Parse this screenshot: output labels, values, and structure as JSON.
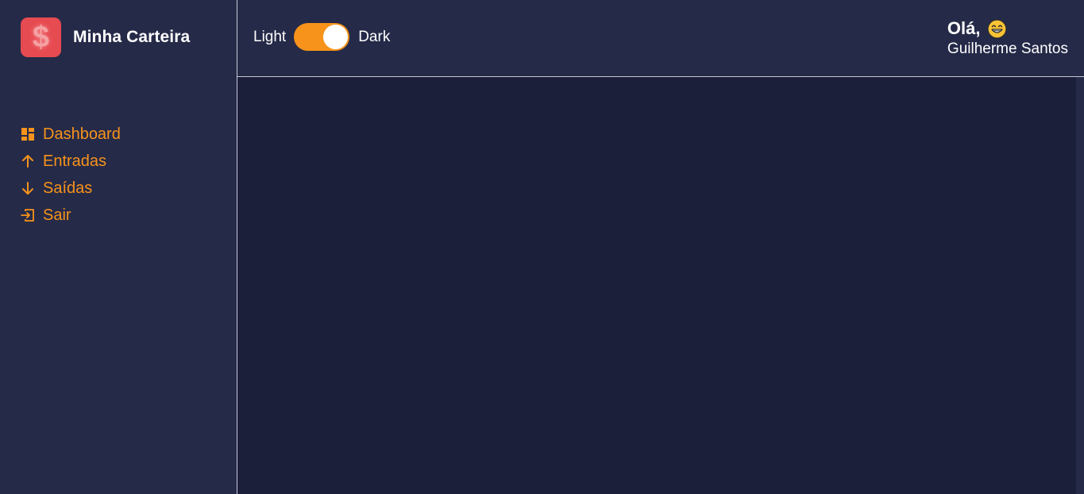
{
  "brand": {
    "logo_symbol": "$",
    "title": "Minha Carteira",
    "logo_color": "#e64b51"
  },
  "sidebar": {
    "items": [
      {
        "label": "Dashboard",
        "icon": "dashboard-icon"
      },
      {
        "label": "Entradas",
        "icon": "arrow-up-icon"
      },
      {
        "label": "Saídas",
        "icon": "arrow-down-icon"
      },
      {
        "label": "Sair",
        "icon": "exit-icon"
      }
    ],
    "accent_color": "#f7931b"
  },
  "header": {
    "theme_toggle": {
      "light_label": "Light",
      "dark_label": "Dark",
      "state": "dark"
    },
    "greeting": "Olá,",
    "greeting_emoji": "grinning-face-icon",
    "user_name": "Guilherme Santos"
  },
  "colors": {
    "sidebar_bg": "#252a48",
    "content_bg": "#1b1f3a",
    "accent": "#f7931b",
    "text": "#ffffff"
  }
}
